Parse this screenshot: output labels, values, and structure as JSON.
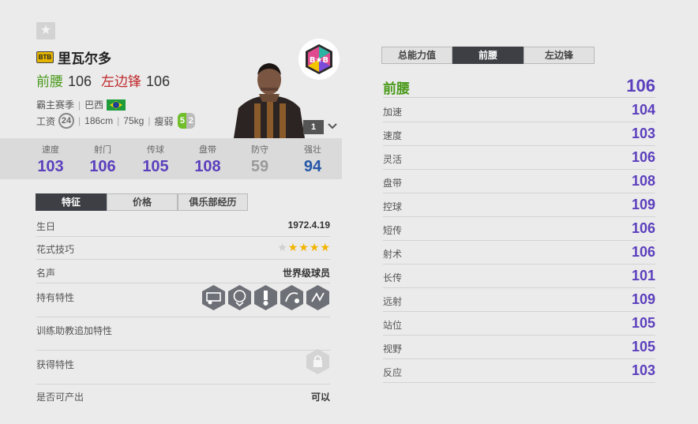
{
  "player": {
    "favorite_icon": "star-icon",
    "season_badge": "BTB",
    "name": "里瓦尔多",
    "positions": [
      {
        "name": "前腰",
        "rating": "106",
        "color": "#4a9a1b"
      },
      {
        "name": "左边锋",
        "rating": "106",
        "color": "#c0292b"
      }
    ],
    "meta_line1": {
      "season": "霸主赛季",
      "nation": "巴西"
    },
    "meta_line2": {
      "wage_label": "工资",
      "wage": "24",
      "height": "186cm",
      "weight": "75kg",
      "build": "瘦弱",
      "strong_foot": "5",
      "weak_foot": "2"
    },
    "club_logo_text": "B★B",
    "enhance_level": "1"
  },
  "summary_stats": [
    {
      "label": "速度",
      "value": "103",
      "color": "#5b3fbd"
    },
    {
      "label": "射门",
      "value": "106",
      "color": "#5b3fbd"
    },
    {
      "label": "传球",
      "value": "105",
      "color": "#5b3fbd"
    },
    {
      "label": "盘带",
      "value": "108",
      "color": "#5b3fbd"
    },
    {
      "label": "防守",
      "value": "59",
      "color": "#9a9a9a"
    },
    {
      "label": "强壮",
      "value": "94",
      "color": "#2457a8"
    }
  ],
  "left_tabs": [
    "特征",
    "价格",
    "俱乐部经历"
  ],
  "details": {
    "birthday": {
      "label": "生日",
      "value": "1972.4.19"
    },
    "skill_moves": {
      "label": "花式技巧",
      "stars": 4,
      "max": 5
    },
    "reputation": {
      "label": "名声",
      "value": "世界级球员"
    },
    "traits": {
      "label": "持有特性",
      "icons": [
        "long-shot-trait-icon",
        "playmaker-trait-icon",
        "power-free-kick-trait-icon",
        "finesse-shot-trait-icon",
        "flair-passes-trait-icon"
      ]
    },
    "coach_traits": {
      "label": "训练助教追加特性"
    },
    "acquired": {
      "label": "获得特性",
      "icon": "lock-icon"
    },
    "producible": {
      "label": "是否可产出",
      "value": "可以"
    }
  },
  "right_tabs": [
    "总能力值",
    "前腰",
    "左边锋"
  ],
  "attr_header": {
    "label": "前腰",
    "value": "106"
  },
  "attributes": [
    {
      "label": "加速",
      "value": "104"
    },
    {
      "label": "速度",
      "value": "103"
    },
    {
      "label": "灵活",
      "value": "106"
    },
    {
      "label": "盘带",
      "value": "108"
    },
    {
      "label": "控球",
      "value": "109"
    },
    {
      "label": "短传",
      "value": "106"
    },
    {
      "label": "射术",
      "value": "106"
    },
    {
      "label": "长传",
      "value": "101"
    },
    {
      "label": "远射",
      "value": "109"
    },
    {
      "label": "站位",
      "value": "105"
    },
    {
      "label": "视野",
      "value": "105"
    },
    {
      "label": "反应",
      "value": "103"
    }
  ]
}
